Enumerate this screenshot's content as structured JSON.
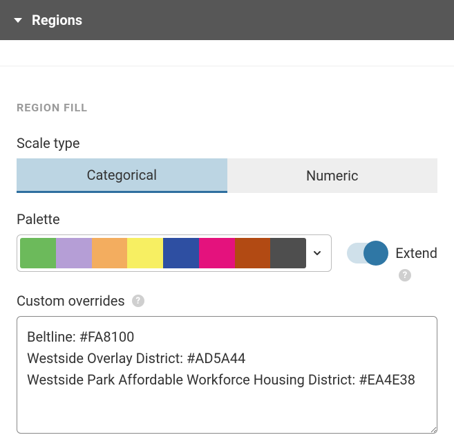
{
  "header": {
    "title": "Regions"
  },
  "section": {
    "label": "REGION FILL"
  },
  "scale_type": {
    "label": "Scale type",
    "tabs": [
      {
        "label": "Categorical",
        "active": true
      },
      {
        "label": "Numeric",
        "active": false
      }
    ]
  },
  "palette": {
    "label": "Palette",
    "colors": [
      "#6cba5b",
      "#b59ed6",
      "#f3ad5f",
      "#f7ef62",
      "#2e4fa2",
      "#e4127d",
      "#b24a13",
      "#4e4e4e"
    ]
  },
  "extend": {
    "label": "Extend",
    "on": true
  },
  "overrides": {
    "label": "Custom overrides",
    "value": "Beltline: #FA8100\nWestside Overlay District: #AD5A44\nWestside Park Affordable Workforce Housing District: #EA4E38"
  }
}
